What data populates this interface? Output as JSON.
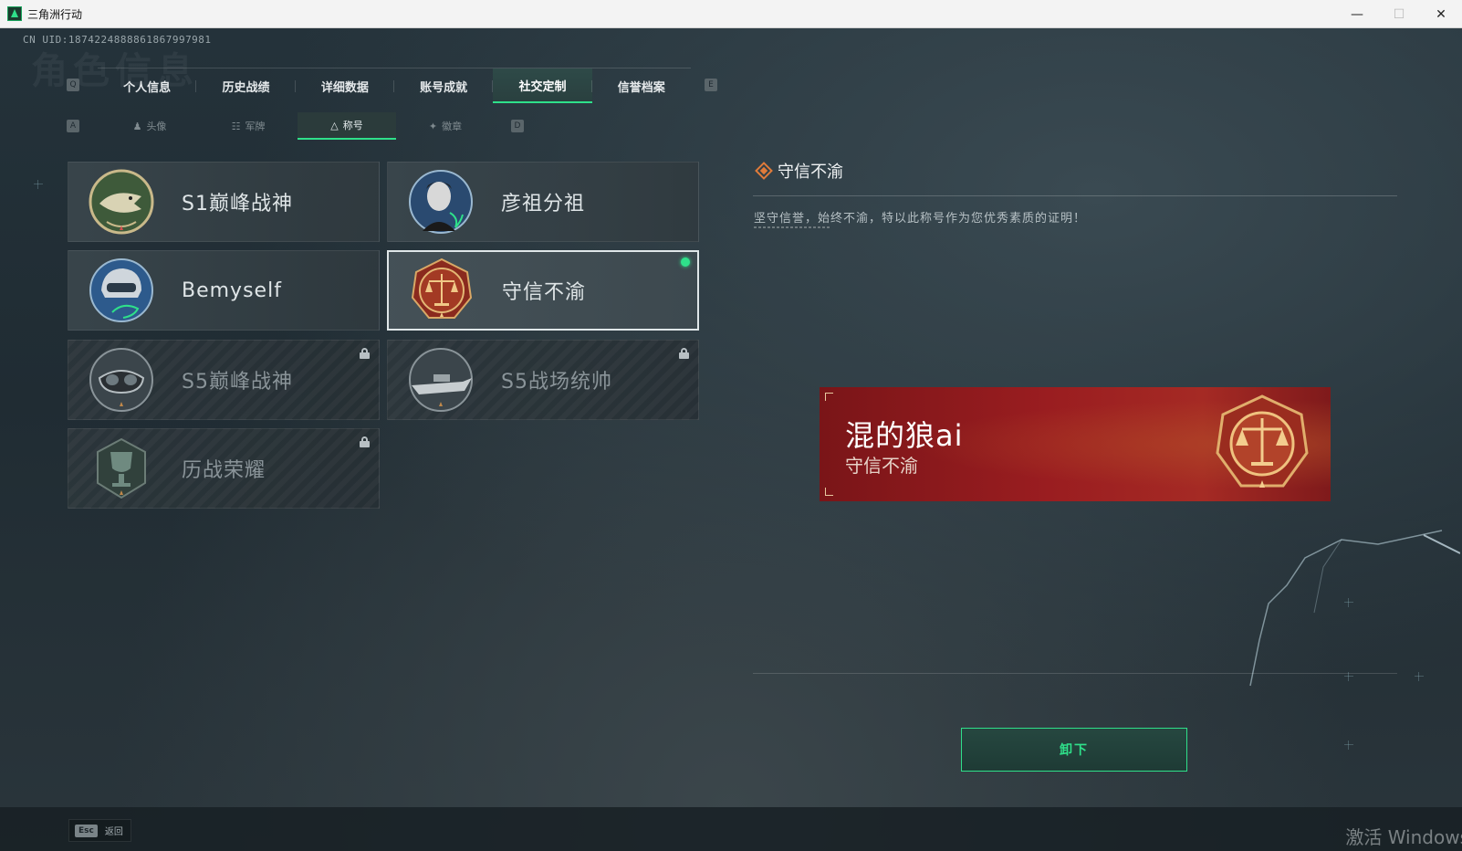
{
  "window": {
    "title": "三角洲行动",
    "controls": [
      "minimize",
      "maximize",
      "close"
    ]
  },
  "uid_text": "CN UID:1874224888861867997981",
  "watermark_title": "角色信息",
  "main_tabs": {
    "prev_key": "Q",
    "next_key": "E",
    "items": [
      {
        "label": "个人信息",
        "active": false
      },
      {
        "label": "历史战绩",
        "active": false
      },
      {
        "label": "详细数据",
        "active": false
      },
      {
        "label": "账号成就",
        "active": false
      },
      {
        "label": "社交定制",
        "active": true
      },
      {
        "label": "信誉档案",
        "active": false
      }
    ]
  },
  "sub_tabs": {
    "prev_key": "A",
    "next_key": "D",
    "items": [
      {
        "label": "头像",
        "icon": "person-icon",
        "active": false
      },
      {
        "label": "军牌",
        "icon": "dogtag-icon",
        "active": false
      },
      {
        "label": "称号",
        "icon": "title-icon",
        "active": true
      },
      {
        "label": "徽章",
        "icon": "medal-icon",
        "active": false
      }
    ]
  },
  "titles": [
    {
      "label": "S1巅峰战神",
      "emblem": "crocodile-emblem-icon",
      "locked": false,
      "selected": false
    },
    {
      "label": "彦祖分祖",
      "emblem": "portrait-emblem-icon",
      "locked": false,
      "selected": false
    },
    {
      "label": "Bemyself",
      "emblem": "helmet-emblem-icon",
      "locked": false,
      "selected": false
    },
    {
      "label": "守信不渝",
      "emblem": "scales-emblem-icon",
      "locked": false,
      "selected": true,
      "equipped": true
    },
    {
      "label": "S5巅峰战神",
      "emblem": "diver-mask-emblem-icon",
      "locked": true,
      "selected": false
    },
    {
      "label": "S5战场统帅",
      "emblem": "boat-emblem-icon",
      "locked": true,
      "selected": false
    },
    {
      "label": "历战荣耀",
      "emblem": "trophy-emblem-icon",
      "locked": true,
      "selected": false
    }
  ],
  "detail": {
    "title": "守信不渝",
    "description": "坚守信誉，始终不渝，特以此称号作为您优秀素质的证明！"
  },
  "banner": {
    "player_name": "混的狼ai",
    "title": "守信不渝"
  },
  "action_button": "卸下",
  "footer": {
    "esc_key": "Esc",
    "esc_label": "返回",
    "os_watermark": "激活 Windows"
  },
  "colors": {
    "accent_green": "#2fe08a",
    "banner_red": "#9a1d20",
    "diamond_orange": "#e07b3a"
  }
}
